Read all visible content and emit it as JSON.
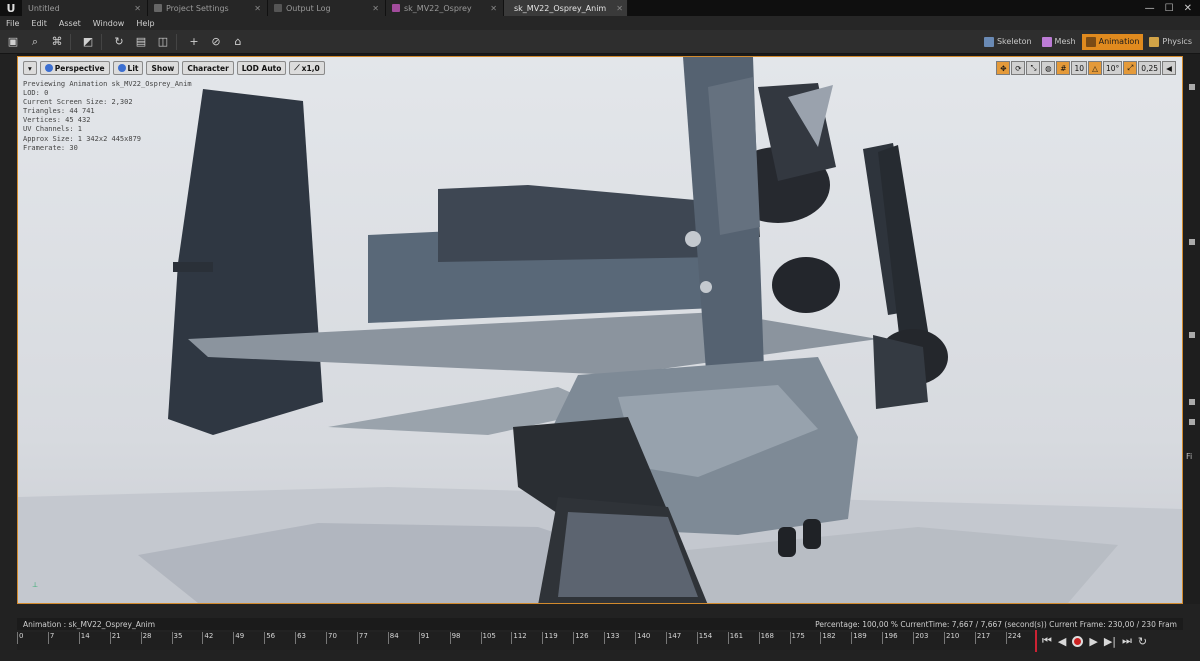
{
  "tabs": [
    {
      "label": "Untitled",
      "active": false
    },
    {
      "label": "Project Settings",
      "active": false
    },
    {
      "label": "Output Log",
      "active": false
    },
    {
      "label": "sk_MV22_Osprey",
      "active": false
    },
    {
      "label": "sk_MV22_Osprey_Anim",
      "active": true
    }
  ],
  "menu": [
    "File",
    "Edit",
    "Asset",
    "Window",
    "Help"
  ],
  "modes": [
    {
      "label": "Skeleton",
      "active": false
    },
    {
      "label": "Mesh",
      "active": false
    },
    {
      "label": "Animation",
      "active": true
    },
    {
      "label": "Physics",
      "active": false
    }
  ],
  "viewport": {
    "menu_btn": "▾",
    "perspective": "Perspective",
    "lit": "Lit",
    "show": "Show",
    "character": "Character",
    "lod": "LOD Auto",
    "speed": "x1,0",
    "grid_snap": "10",
    "rot_snap": "10°",
    "scale_snap": "0,25"
  },
  "stats": [
    "Previewing Animation sk_MV22_Osprey_Anim",
    "LOD: 0",
    "Current Screen Size: 2,302",
    "Triangles: 44 741",
    "Vertices: 45 432",
    "UV Channels: 1",
    "Approx Size: 1 342x2 445x879",
    "Framerate: 30"
  ],
  "anim": {
    "label": "Animation : sk_MV22_Osprey_Anim",
    "status": "Percentage: 100,00 % CurrentTime: 7,667 / 7,667 (second(s)) Current Frame: 230,00 / 230 Fram"
  },
  "ticks": [
    "0",
    "7",
    "14",
    "21",
    "28",
    "35",
    "42",
    "49",
    "56",
    "63",
    "70",
    "77",
    "84",
    "91",
    "98",
    "105",
    "112",
    "119",
    "126",
    "133",
    "140",
    "147",
    "154",
    "161",
    "168",
    "175",
    "182",
    "189",
    "196",
    "203",
    "210",
    "217",
    "224"
  ],
  "right_labels": [
    "Fi"
  ],
  "colors": {
    "accent": "#e08a1e",
    "playhead": "#cc2233"
  }
}
